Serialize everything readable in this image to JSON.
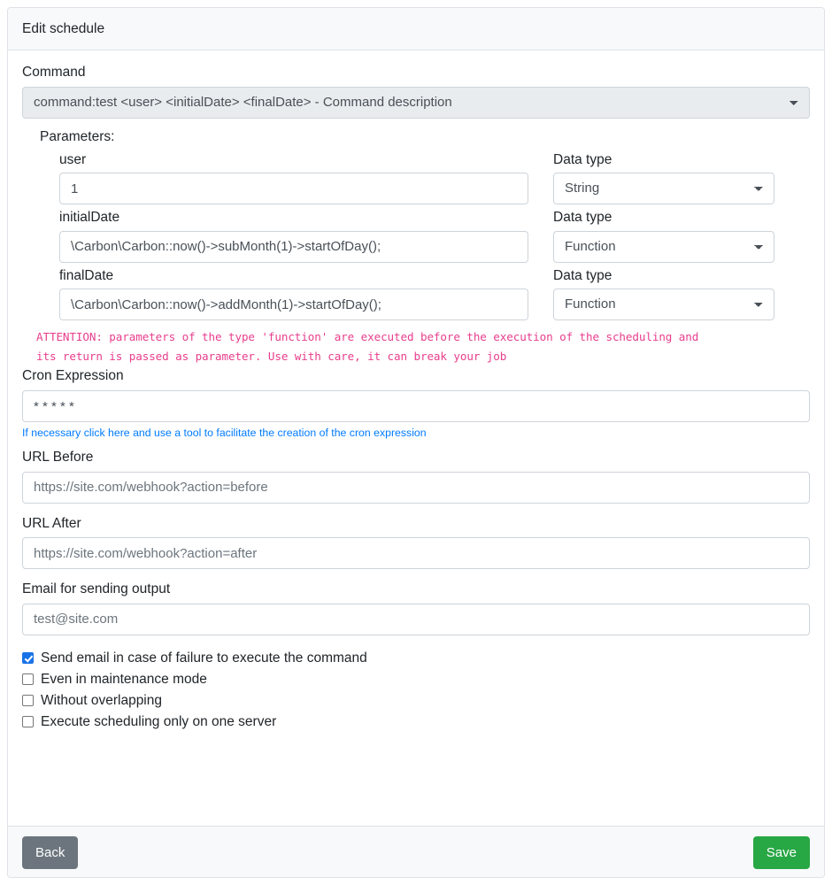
{
  "header": {
    "title": "Edit schedule"
  },
  "command": {
    "label": "Command",
    "selected": "command:test <user> <initialDate> <finalDate> - Command description"
  },
  "parameters": {
    "title": "Parameters:",
    "data_type_label": "Data type",
    "rows": [
      {
        "name": "user",
        "value": "1",
        "type": "String"
      },
      {
        "name": "initialDate",
        "value": "\\Carbon\\Carbon::now()->subMonth(1)->startOfDay();",
        "type": "Function"
      },
      {
        "name": "finalDate",
        "value": "\\Carbon\\Carbon::now()->addMonth(1)->startOfDay();",
        "type": "Function"
      }
    ],
    "attention_line1": "ATTENTION: parameters of the type 'function' are executed before the execution of the scheduling and",
    "attention_line2": "its return is passed as parameter. Use with care, it can break your job"
  },
  "cron": {
    "label": "Cron Expression",
    "value": "* * * * *",
    "helper_link": "If necessary click here and use a tool to facilitate the creation of the cron expression"
  },
  "url_before": {
    "label": "URL Before",
    "placeholder": "https://site.com/webhook?action=before"
  },
  "url_after": {
    "label": "URL After",
    "placeholder": "https://site.com/webhook?action=after"
  },
  "email": {
    "label": "Email for sending output",
    "placeholder": "test@site.com"
  },
  "checkboxes": [
    {
      "label": "Send email in case of failure to execute the command",
      "checked": true
    },
    {
      "label": "Even in maintenance mode",
      "checked": false
    },
    {
      "label": "Without overlapping",
      "checked": false
    },
    {
      "label": "Execute scheduling only on one server",
      "checked": false
    }
  ],
  "footer": {
    "back_label": "Back",
    "save_label": "Save"
  },
  "colors": {
    "accent_link": "#007bff",
    "attention": "#e83e8c",
    "save": "#28a745",
    "back": "#6c757d",
    "checkbox_checked": "#1a73e8",
    "header_bg": "#f8f9fa",
    "border": "#dee2e6"
  }
}
